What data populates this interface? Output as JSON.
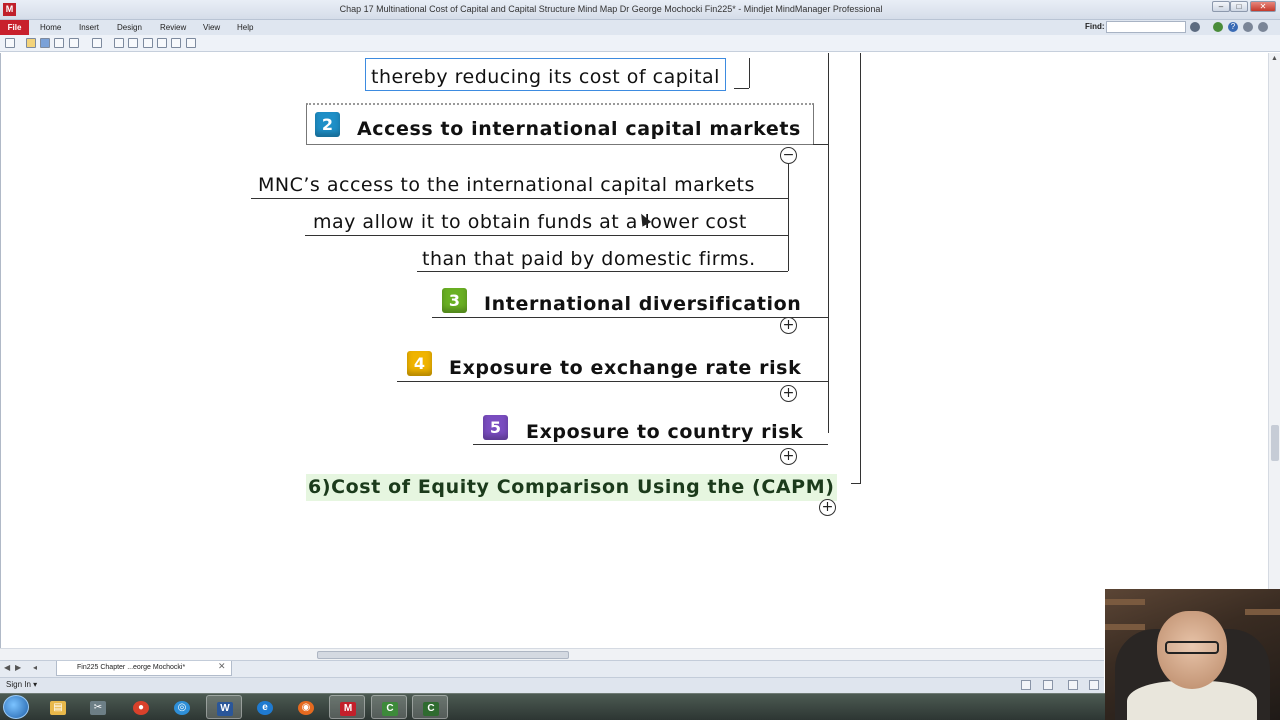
{
  "window": {
    "title": "Chap 17 Multinational Cost of Capital and Capital Structure Mind Map Dr George Mochocki Fin225* - Mindjet MindManager Professional",
    "app_icon_letter": "M",
    "buttons": {
      "minimize": "–",
      "maximize": "□",
      "close": "✕"
    }
  },
  "ribbon": {
    "tabs": [
      "File",
      "Home",
      "Insert",
      "Design",
      "Review",
      "View",
      "Help"
    ],
    "find_label": "Find:",
    "find_value": ""
  },
  "mindmap": {
    "top_subtopic": "thereby reducing its cost of capital",
    "topics": [
      {
        "number": "2",
        "label": "Access to international capital markets",
        "badge_color": "#1e8fc7",
        "toggle": "−",
        "subtopics": [
          "MNC’s access to the international capital markets",
          "may allow it to obtain funds at a lower cost",
          "than that paid by domestic firms."
        ]
      },
      {
        "number": "3",
        "label": "International diversification",
        "badge_color": "#6ab023",
        "toggle": "+"
      },
      {
        "number": "4",
        "label": "Exposure to exchange rate risk",
        "badge_color": "#f0b400",
        "toggle": "+"
      },
      {
        "number": "5",
        "label": "Exposure to country risk",
        "badge_color": "#7a4dc0",
        "toggle": "+"
      }
    ],
    "main_topic": {
      "label": "6)Cost of Equity Comparison Using the (CAPM)",
      "background": "#e6f6e0",
      "text_color": "#1b3a1b",
      "toggle": "+"
    }
  },
  "document_tab": {
    "label": "Fin225 Chapter ...eorge Mochocki*",
    "close": "✕"
  },
  "statusbar": {
    "signin": "Sign In ▾"
  },
  "taskbar": {
    "items": [
      {
        "name": "start",
        "glyph": ""
      },
      {
        "name": "explorer",
        "glyph": "▤",
        "color": "#e8b84a"
      },
      {
        "name": "app-snipping",
        "glyph": "✂",
        "color": "#6d7f86"
      },
      {
        "name": "chrome",
        "glyph": "●",
        "color": "#d9412b"
      },
      {
        "name": "app-globe",
        "glyph": "◎",
        "color": "#2e8fd8"
      },
      {
        "name": "word",
        "glyph": "W",
        "color": "#2a5699"
      },
      {
        "name": "internet-explorer",
        "glyph": "e",
        "color": "#1f7bd1"
      },
      {
        "name": "firefox",
        "glyph": "◉",
        "color": "#e66a1f"
      },
      {
        "name": "mindmanager",
        "glyph": "M",
        "color": "#c3202b"
      },
      {
        "name": "camtasia-recorder",
        "glyph": "C",
        "color": "#3d8a3a"
      },
      {
        "name": "camtasia",
        "glyph": "C",
        "color": "#2f6b30"
      }
    ]
  }
}
